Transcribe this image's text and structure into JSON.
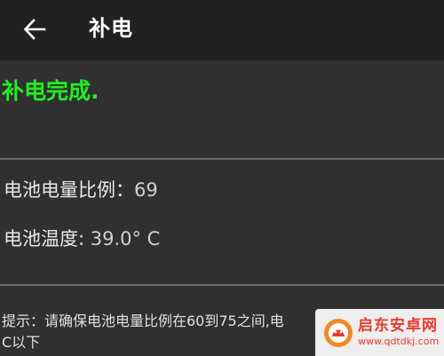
{
  "toolbar": {
    "title": "补电",
    "back_icon": "arrow-left-icon"
  },
  "status": {
    "text": "补电完成.",
    "color": "#22ee22"
  },
  "battery": {
    "level_label": "电池电量比例：",
    "level_value": "69",
    "temp_label": "电池温度:",
    "temp_value": " 39.0° C"
  },
  "hint": {
    "line1": "提示：请确保电池电量比例在60到75之间,电",
    "line2": "C以下"
  },
  "watermark": {
    "title": "启东安卓网",
    "url": "www.qdtdkj.com",
    "accent": "#e53b2f"
  }
}
